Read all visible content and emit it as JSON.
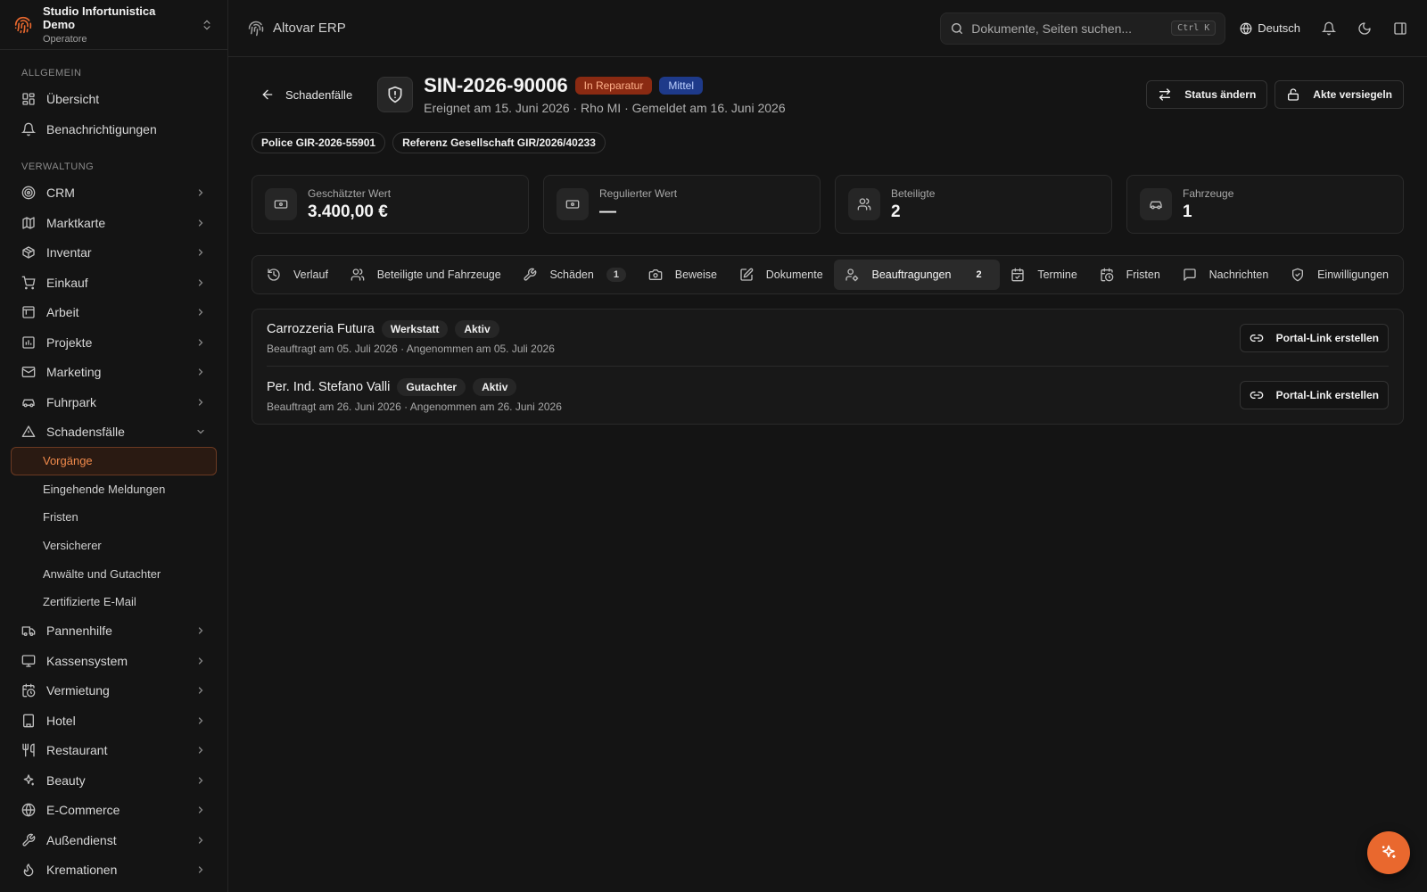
{
  "org": {
    "name": "Studio Infortunistica Demo",
    "role": "Operatore"
  },
  "sidebar": {
    "section_general": "ALLGEMEIN",
    "general_items": [
      {
        "label": "Übersicht",
        "icon": "dashboard-icon"
      },
      {
        "label": "Benachrichtigungen",
        "icon": "bell-icon"
      }
    ],
    "section_admin": "VERWALTUNG",
    "admin_items": [
      {
        "label": "CRM",
        "icon": "target-icon"
      },
      {
        "label": "Marktkarte",
        "icon": "map-icon"
      },
      {
        "label": "Inventar",
        "icon": "package-icon"
      },
      {
        "label": "Einkauf",
        "icon": "cart-icon"
      },
      {
        "label": "Arbeit",
        "icon": "clipboard-icon"
      },
      {
        "label": "Projekte",
        "icon": "chart-icon"
      },
      {
        "label": "Marketing",
        "icon": "mail-icon"
      },
      {
        "label": "Fuhrpark",
        "icon": "car-icon"
      }
    ],
    "expanded": {
      "label": "Schadensfälle",
      "icon": "warning-icon"
    },
    "sub_items": [
      {
        "label": "Vorgänge"
      },
      {
        "label": "Eingehende Meldungen"
      },
      {
        "label": "Fristen"
      },
      {
        "label": "Versicherer"
      },
      {
        "label": "Anwälte und Gutachter"
      },
      {
        "label": "Zertifizierte E-Mail"
      }
    ],
    "more_items": [
      {
        "label": "Pannenhilfe",
        "icon": "truck-icon"
      },
      {
        "label": "Kassensystem",
        "icon": "monitor-icon"
      },
      {
        "label": "Vermietung",
        "icon": "calendar-clock-icon"
      },
      {
        "label": "Hotel",
        "icon": "building-icon"
      },
      {
        "label": "Restaurant",
        "icon": "utensils-icon"
      },
      {
        "label": "Beauty",
        "icon": "sparkles-icon"
      },
      {
        "label": "E-Commerce",
        "icon": "globe-icon"
      },
      {
        "label": "Außendienst",
        "icon": "wrench-icon"
      },
      {
        "label": "Kremationen",
        "icon": "flame-icon"
      }
    ]
  },
  "topbar": {
    "brand": "Altovar ERP",
    "search_placeholder": "Dokumente, Seiten suchen...",
    "shortcut": "Ctrl K",
    "language": "Deutsch"
  },
  "case": {
    "back_label": "Schadenfälle",
    "id": "SIN-2026-90006",
    "status": "In Reparatur",
    "priority": "Mittel",
    "meta": "Ereignet am 15. Juni 2026 · Rho MI · Gemeldet am 16. Juni 2026",
    "action_status": "Status ändern",
    "action_seal": "Akte versiegeln",
    "chips": [
      "Police GIR-2026-55901",
      "Referenz Gesellschaft GIR/2026/40233"
    ]
  },
  "stats": [
    {
      "label": "Geschätzter Wert",
      "value": "3.400,00 €",
      "icon": "banknote-icon"
    },
    {
      "label": "Regulierter Wert",
      "value": "—",
      "icon": "banknote-icon"
    },
    {
      "label": "Beteiligte",
      "value": "2",
      "icon": "users-icon"
    },
    {
      "label": "Fahrzeuge",
      "value": "1",
      "icon": "car-icon"
    }
  ],
  "tabs": [
    {
      "label": "Verlauf",
      "icon": "history-icon"
    },
    {
      "label": "Beteiligte und Fahrzeuge",
      "icon": "users-icon"
    },
    {
      "label": "Schäden",
      "icon": "wrench-icon",
      "count": "1"
    },
    {
      "label": "Beweise",
      "icon": "camera-icon"
    },
    {
      "label": "Dokumente",
      "icon": "file-edit-icon"
    },
    {
      "label": "Beauftragungen",
      "icon": "user-cog-icon",
      "count": "2",
      "active": true
    },
    {
      "label": "Termine",
      "icon": "calendar-check-icon"
    },
    {
      "label": "Fristen",
      "icon": "calendar-clock-icon"
    },
    {
      "label": "Nachrichten",
      "icon": "message-icon"
    },
    {
      "label": "Einwilligungen",
      "icon": "shield-check-icon"
    }
  ],
  "assignments": [
    {
      "name": "Carrozzeria Futura",
      "role": "Werkstatt",
      "state": "Aktiv",
      "meta": "Beauftragt am 05. Juli 2026 · Angenommen am 05. Juli 2026",
      "action": "Portal-Link erstellen"
    },
    {
      "name": "Per. Ind. Stefano Valli",
      "role": "Gutachter",
      "state": "Aktiv",
      "meta": "Beauftragt am 26. Juni 2026 · Angenommen am 26. Juni 2026",
      "action": "Portal-Link erstellen"
    }
  ],
  "colors": {
    "accent": "#e9682e",
    "status_bg": "#8a2a12",
    "priority_bg": "#1e3a8a"
  }
}
